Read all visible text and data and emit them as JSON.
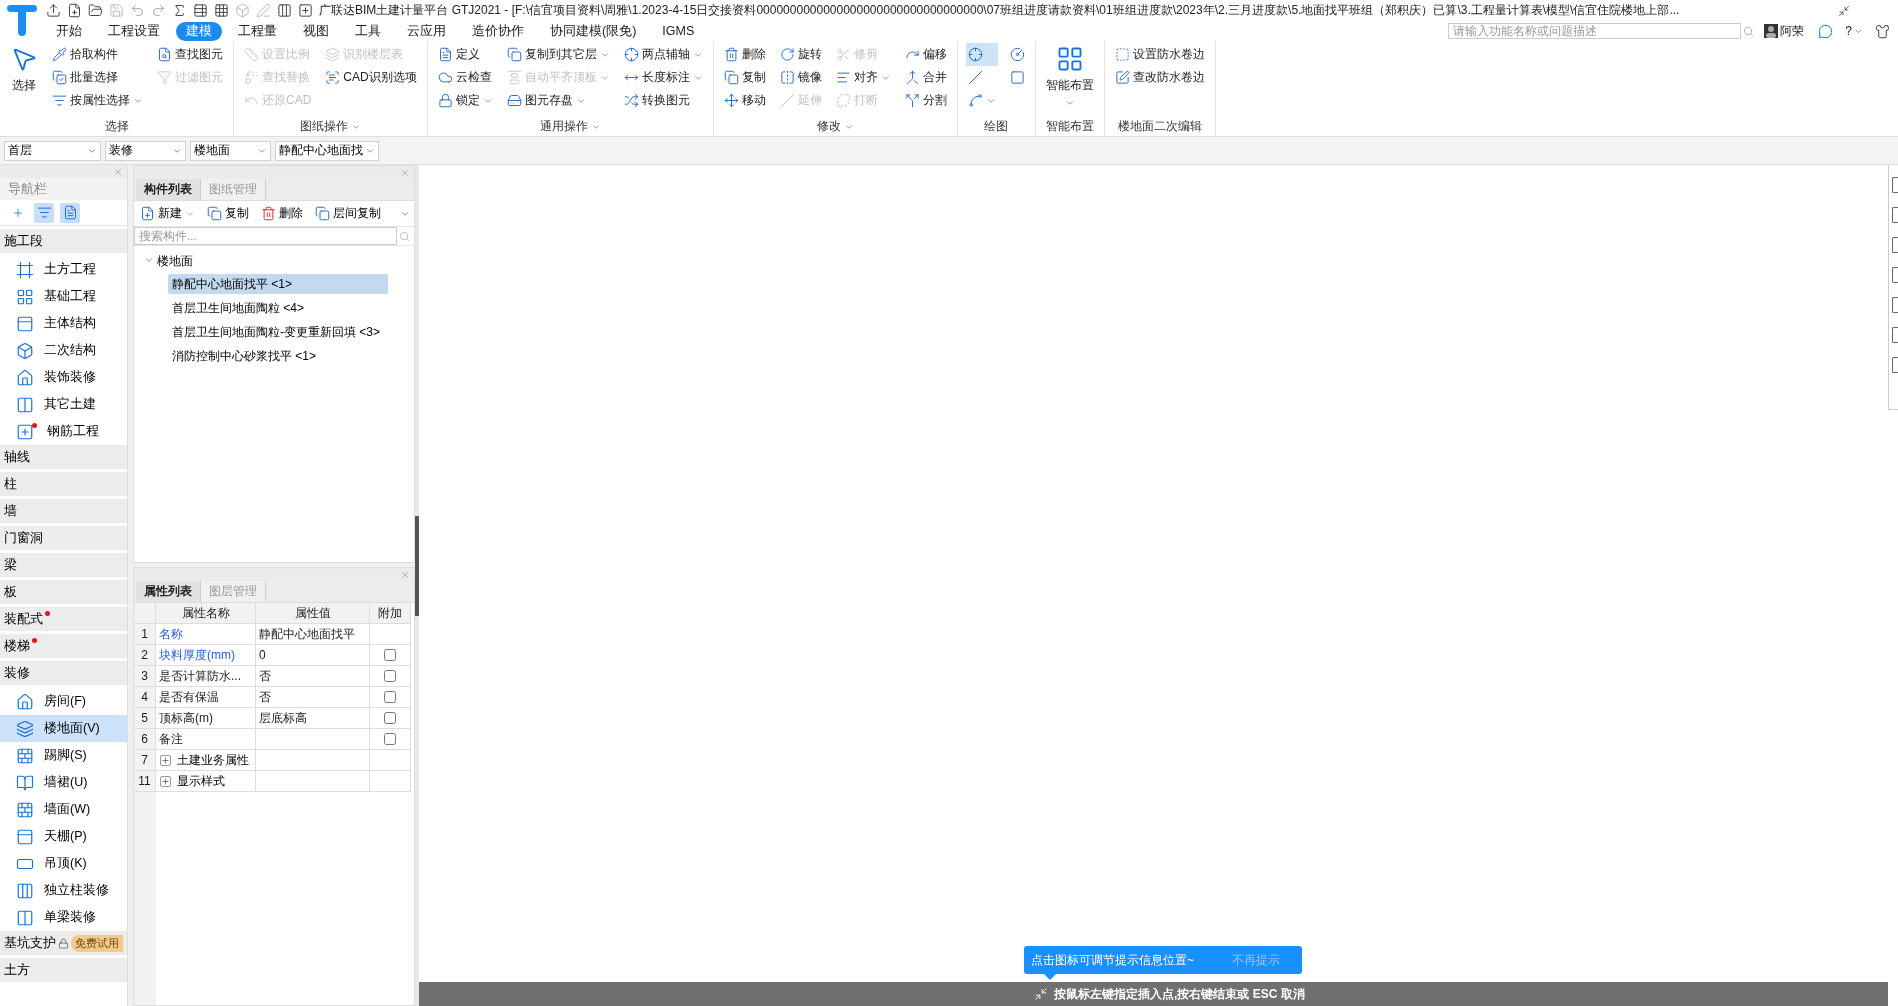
{
  "window": {
    "title": "广联达BIM土建计量平台 GTJ2021 - [F:\\信宜项目资料\\周雅\\1.2023-4-15日交接资料0000000000000000000000000000000000\\07班组进度请款资料\\01班组进度款\\2023年\\2.三月进度款\\5.地面找平班组（郑积庆）已算\\3.工程量计算表\\模型\\信宜住院楼地上部..."
  },
  "menu": {
    "tabs": [
      {
        "label": "开始",
        "selected": false
      },
      {
        "label": "工程设置",
        "selected": false
      },
      {
        "label": "建模",
        "selected": true
      },
      {
        "label": "工程量",
        "selected": false
      },
      {
        "label": "视图",
        "selected": false
      },
      {
        "label": "工具",
        "selected": false
      },
      {
        "label": "云应用",
        "selected": false
      },
      {
        "label": "造价协作",
        "selected": false
      },
      {
        "label": "协同建模(限免)",
        "selected": false
      },
      {
        "label": "IGMS",
        "selected": false
      }
    ],
    "search": {
      "placeholder": "请输入功能名称或问题描述"
    },
    "user": "阿荣",
    "help": "?"
  },
  "ribbon": [
    {
      "label": "选择",
      "dropdown": false,
      "items": [
        {
          "kind": "large",
          "label": "选择",
          "disabled": false,
          "dropdown": false
        },
        {
          "kind": "small",
          "label": "拾取构件",
          "disabled": false,
          "dropdown": false
        },
        {
          "kind": "small",
          "label": "批量选择",
          "disabled": false,
          "dropdown": false
        },
        {
          "kind": "small",
          "label": "按属性选择",
          "disabled": false,
          "dropdown": true
        },
        {
          "kind": "small",
          "label": "查找图元",
          "disabled": false,
          "dropdown": false
        },
        {
          "kind": "small",
          "label": "过滤图元",
          "disabled": true,
          "dropdown": false
        }
      ]
    },
    {
      "label": "图纸操作",
      "dropdown": true,
      "items": [
        {
          "kind": "small",
          "label": "设置比例",
          "disabled": true,
          "dropdown": false
        },
        {
          "kind": "small",
          "label": "查找替换",
          "disabled": true,
          "dropdown": false
        },
        {
          "kind": "small",
          "label": "还原CAD",
          "disabled": true,
          "dropdown": false
        },
        {
          "kind": "small",
          "label": "识别楼层表",
          "disabled": true,
          "dropdown": false
        },
        {
          "kind": "small",
          "label": "CAD识别选项",
          "disabled": false,
          "dropdown": false
        }
      ]
    },
    {
      "label": "通用操作",
      "dropdown": true,
      "items": [
        {
          "kind": "small",
          "label": "定义",
          "disabled": false,
          "dropdown": false
        },
        {
          "kind": "small",
          "label": "云检查",
          "disabled": false,
          "dropdown": false
        },
        {
          "kind": "small",
          "label": "锁定",
          "disabled": false,
          "dropdown": true
        },
        {
          "kind": "small",
          "label": "复制到其它层",
          "disabled": false,
          "dropdown": true
        },
        {
          "kind": "small",
          "label": "自动平齐顶板",
          "disabled": true,
          "dropdown": true
        },
        {
          "kind": "small",
          "label": "图元存盘",
          "disabled": false,
          "dropdown": true
        },
        {
          "kind": "small",
          "label": "两点辅轴",
          "disabled": false,
          "dropdown": true
        },
        {
          "kind": "small",
          "label": "长度标注",
          "disabled": false,
          "dropdown": true
        },
        {
          "kind": "small",
          "label": "转换图元",
          "disabled": false,
          "dropdown": false
        }
      ]
    },
    {
      "label": "修改",
      "dropdown": true,
      "items": [
        {
          "kind": "small",
          "label": "删除",
          "disabled": false,
          "dropdown": false
        },
        {
          "kind": "small",
          "label": "复制",
          "disabled": false,
          "dropdown": false
        },
        {
          "kind": "small",
          "label": "移动",
          "disabled": false,
          "dropdown": false
        },
        {
          "kind": "small",
          "label": "旋转",
          "disabled": false,
          "dropdown": false
        },
        {
          "kind": "small",
          "label": "镜像",
          "disabled": false,
          "dropdown": false
        },
        {
          "kind": "small",
          "label": "延伸",
          "disabled": true,
          "dropdown": false
        },
        {
          "kind": "small",
          "label": "修剪",
          "disabled": true,
          "dropdown": false
        },
        {
          "kind": "small",
          "label": "对齐",
          "disabled": false,
          "dropdown": true
        },
        {
          "kind": "small",
          "label": "打断",
          "disabled": true,
          "dropdown": false
        },
        {
          "kind": "small",
          "label": "偏移",
          "disabled": false,
          "dropdown": false
        },
        {
          "kind": "small",
          "label": "合并",
          "disabled": false,
          "dropdown": false
        },
        {
          "kind": "small",
          "label": "分割",
          "disabled": false,
          "dropdown": false
        }
      ]
    },
    {
      "label": "绘图",
      "dropdown": false,
      "items": [
        {
          "kind": "icon",
          "selected": true,
          "dropdown": false
        },
        {
          "kind": "icon",
          "selected": false,
          "dropdown": false
        },
        {
          "kind": "icon",
          "selected": false,
          "dropdown": true
        },
        {
          "kind": "icon",
          "selected": false,
          "dropdown": false
        },
        {
          "kind": "icon",
          "selected": false,
          "dropdown": false
        }
      ]
    },
    {
      "label": "智能布置",
      "dropdown": false,
      "items": [
        {
          "kind": "large",
          "label": "智能布置",
          "disabled": false,
          "dropdown": true
        }
      ]
    },
    {
      "label": "楼地面二次编辑",
      "dropdown": false,
      "items": [
        {
          "kind": "small",
          "label": "设置防水卷边",
          "disabled": false,
          "dropdown": false
        },
        {
          "kind": "small",
          "label": "查改防水卷边",
          "disabled": false,
          "dropdown": false
        }
      ]
    }
  ],
  "selectors": [
    "首层",
    "装修",
    "楼地面",
    "静配中心地面找"
  ],
  "navigation": {
    "title": "导航栏",
    "sections": [
      {
        "label": "施工段",
        "dot": false,
        "children": [
          {
            "label": "土方工程",
            "selected": false,
            "dot": false
          },
          {
            "label": "基础工程",
            "selected": false,
            "dot": false
          },
          {
            "label": "主体结构",
            "selected": false,
            "dot": false
          },
          {
            "label": "二次结构",
            "selected": false,
            "dot": false
          },
          {
            "label": "装饰装修",
            "selected": false,
            "dot": false
          },
          {
            "label": "其它土建",
            "selected": false,
            "dot": false
          },
          {
            "label": "钢筋工程",
            "selected": false,
            "dot": true
          }
        ]
      },
      {
        "label": "轴线",
        "dot": false
      },
      {
        "label": "柱",
        "dot": false
      },
      {
        "label": "墙",
        "dot": false
      },
      {
        "label": "门窗洞",
        "dot": false
      },
      {
        "label": "梁",
        "dot": false
      },
      {
        "label": "板",
        "dot": false
      },
      {
        "label": "装配式",
        "dot": true
      },
      {
        "label": "楼梯",
        "dot": true
      },
      {
        "label": "装修",
        "dot": false,
        "children": [
          {
            "label": "房间(F)",
            "selected": false,
            "dot": false
          },
          {
            "label": "楼地面(V)",
            "selected": true,
            "dot": false
          },
          {
            "label": "踢脚(S)",
            "selected": false,
            "dot": false
          },
          {
            "label": "墙裙(U)",
            "selected": false,
            "dot": false
          },
          {
            "label": "墙面(W)",
            "selected": false,
            "dot": false
          },
          {
            "label": "天棚(P)",
            "selected": false,
            "dot": false
          },
          {
            "label": "吊顶(K)",
            "selected": false,
            "dot": false
          },
          {
            "label": "独立柱装修",
            "selected": false,
            "dot": false
          },
          {
            "label": "单梁装修",
            "selected": false,
            "dot": false
          }
        ]
      },
      {
        "label": "基坑支护",
        "dot": false,
        "locked": true,
        "tag": "免费试用"
      },
      {
        "label": "土方",
        "dot": false
      }
    ]
  },
  "components": {
    "tabs": [
      {
        "label": "构件列表",
        "selected": true
      },
      {
        "label": "图纸管理",
        "selected": false
      }
    ],
    "toolbar": [
      {
        "label": "新建",
        "dropdown": true
      },
      {
        "label": "复制",
        "dropdown": false
      },
      {
        "label": "删除",
        "dropdown": false
      },
      {
        "label": "层间复制",
        "dropdown": false
      }
    ],
    "search": {
      "placeholder": "搜索构件..."
    },
    "tree": {
      "label": "楼地面",
      "expanded": true,
      "children": [
        {
          "label": "静配中心地面找平 <1>",
          "selected": true
        },
        {
          "label": "首层卫生间地面陶粒 <4>",
          "selected": false
        },
        {
          "label": "首层卫生间地面陶粒-变更重新回填 <3>",
          "selected": false
        },
        {
          "label": "消防控制中心砂浆找平 <1>",
          "selected": false
        }
      ]
    }
  },
  "properties": {
    "tabs": [
      {
        "label": "属性列表",
        "selected": true
      },
      {
        "label": "图层管理",
        "selected": false
      }
    ],
    "columns": [
      "属性名称",
      "属性值",
      "附加"
    ],
    "rows": [
      {
        "kind": "field",
        "number": "1",
        "name": "名称",
        "value": "静配中心地面找平",
        "required": true
      },
      {
        "kind": "field",
        "number": "2",
        "name": "块料厚度(mm)",
        "value": "0",
        "required": true,
        "checked": false
      },
      {
        "kind": "field",
        "number": "3",
        "name": "是否计算防水...",
        "value": "否",
        "required": false,
        "checked": false
      },
      {
        "kind": "field",
        "number": "4",
        "name": "是否有保温",
        "value": "否",
        "required": false,
        "checked": false
      },
      {
        "kind": "field",
        "number": "5",
        "name": "顶标高(m)",
        "value": "层底标高",
        "required": false,
        "checked": false
      },
      {
        "kind": "field",
        "number": "6",
        "name": "备注",
        "required": false,
        "checked": false
      },
      {
        "kind": "group",
        "number": "7",
        "name": "土建业务属性",
        "expanded": false
      },
      {
        "kind": "group",
        "number": "11",
        "name": "显示样式",
        "expanded": false
      }
    ]
  },
  "canvas": {
    "tip": {
      "text": "点击图标可调节提示信息位置~",
      "action": "不再提示"
    },
    "status": "按鼠标左键指定插入点,按右键结束或 ESC 取消"
  }
}
